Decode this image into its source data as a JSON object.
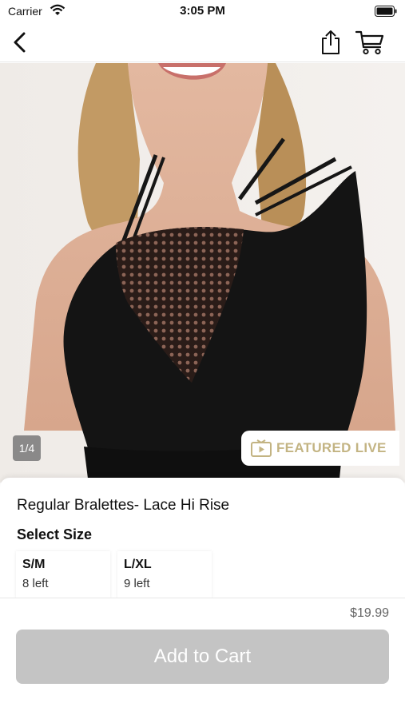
{
  "status_bar": {
    "carrier": "Carrier",
    "time": "3:05 PM"
  },
  "nav": {
    "back_icon": "chevron-left-icon",
    "share_icon": "share-icon",
    "cart_icon": "cart-icon"
  },
  "gallery": {
    "page_counter": "1/4",
    "badge_label": "FEATURED LIVE",
    "badge_icon": "tv-play-icon",
    "badge_color": "#c3b483"
  },
  "product": {
    "title": "Regular Bralettes- Lace Hi Rise",
    "select_size_label": "Select Size",
    "sizes": [
      {
        "name": "S/M",
        "stock": "8 left"
      },
      {
        "name": "L/XL",
        "stock": "9 left"
      }
    ]
  },
  "footer": {
    "price": "$19.99",
    "add_to_cart_label": "Add to Cart",
    "button_color": "#c4c4c4"
  }
}
